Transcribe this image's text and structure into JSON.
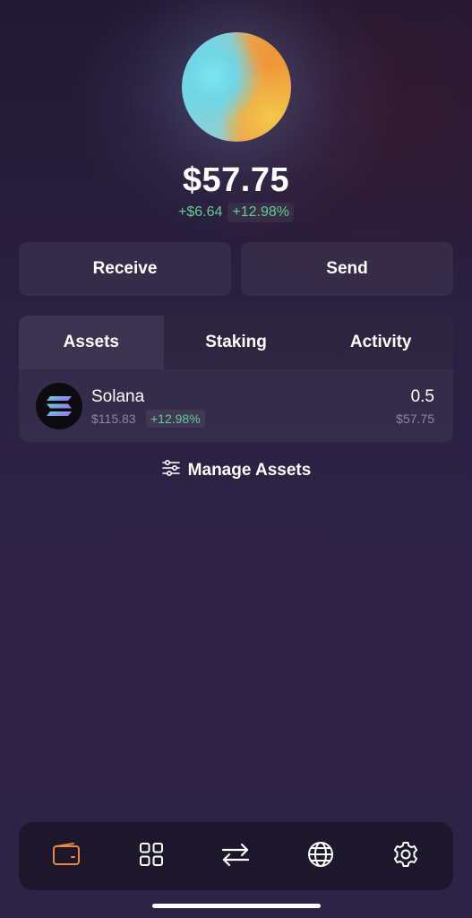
{
  "wallet": {
    "balance": "$57.75",
    "change_amount": "+$6.64",
    "change_percent": "+12.98%",
    "gradient_colors": [
      "#73d6ea",
      "#f0953a",
      "#f2c94c"
    ]
  },
  "actions": {
    "receive_label": "Receive",
    "send_label": "Send"
  },
  "tabs": [
    {
      "label": "Assets",
      "active": true
    },
    {
      "label": "Staking",
      "active": false
    },
    {
      "label": "Activity",
      "active": false
    }
  ],
  "assets": [
    {
      "name": "Solana",
      "price": "$115.83",
      "change": "+12.98%",
      "amount": "0.5",
      "value": "$57.75",
      "icon": "solana-icon"
    }
  ],
  "manage": {
    "label": "Manage Assets",
    "icon": "sliders-icon"
  },
  "bottom_nav": [
    {
      "icon": "wallet-icon",
      "active": true
    },
    {
      "icon": "grid-icon",
      "active": false
    },
    {
      "icon": "swap-icon",
      "active": false
    },
    {
      "icon": "globe-icon",
      "active": false
    },
    {
      "icon": "gear-icon",
      "active": false
    }
  ],
  "colors": {
    "positive": "#5fcf8a",
    "active_nav": "#f0853e",
    "muted_text": "#8e879c"
  }
}
